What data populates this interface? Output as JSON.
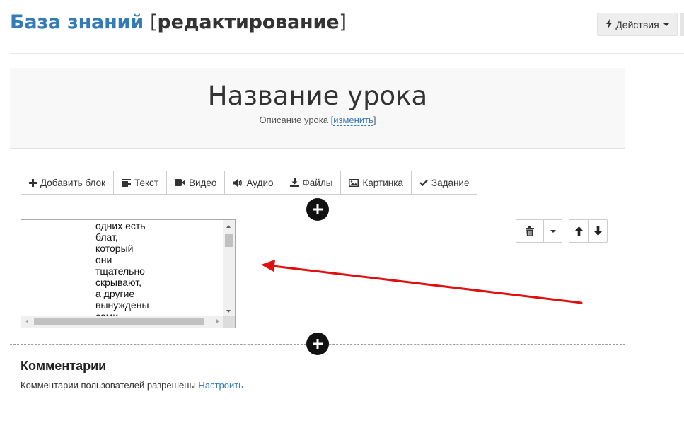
{
  "header": {
    "title_main": "База знаний",
    "title_mode": "редактирование",
    "actions_label": "Действия"
  },
  "lesson": {
    "title": "Название урока",
    "description": "Описание урока",
    "edit_link": "изменить"
  },
  "toolbar": {
    "items": [
      {
        "label": "Добавить блок",
        "icon": "plus-icon"
      },
      {
        "label": "Текст",
        "icon": "align-left-icon"
      },
      {
        "label": "Видео",
        "icon": "video-camera-icon"
      },
      {
        "label": "Аудио",
        "icon": "volume-icon"
      },
      {
        "label": "Файлы",
        "icon": "download-icon"
      },
      {
        "label": "Картинка",
        "icon": "image-icon"
      },
      {
        "label": "Задание",
        "icon": "check-icon"
      }
    ]
  },
  "editor": {
    "lines": [
      "одних есть",
      "блат,",
      "который",
      "они",
      "тщательно",
      "скрывают,",
      "а другие",
      "вынуждены",
      "сами"
    ]
  },
  "comments": {
    "title": "Комментарии",
    "text": "Комментарии пользователей разрешены",
    "configure_link": "Настроить"
  },
  "colors": {
    "accent": "#337ab7",
    "annotation_arrow": "#e01010"
  }
}
